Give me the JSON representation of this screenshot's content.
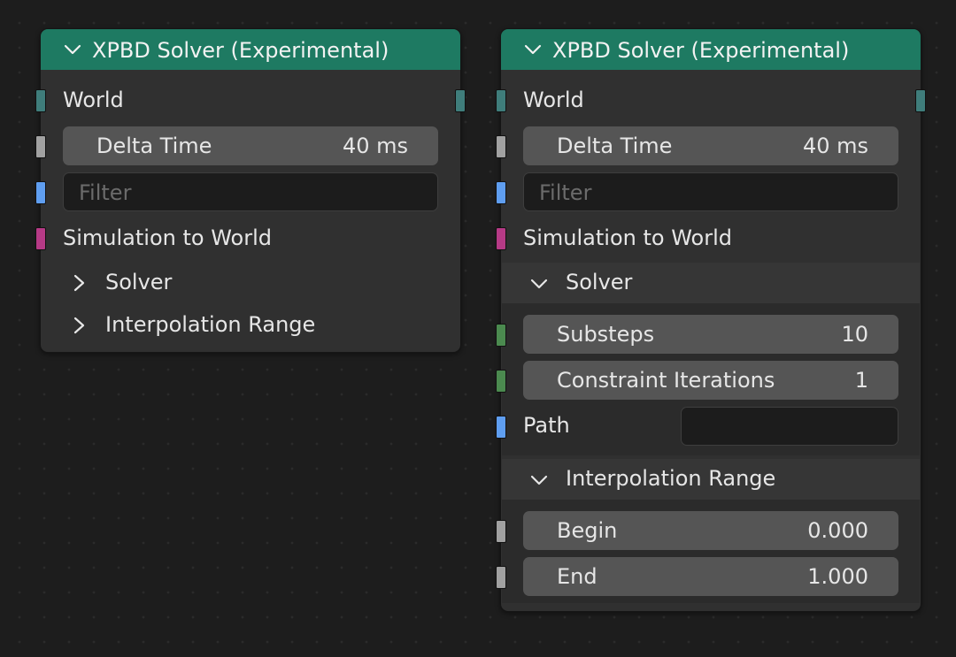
{
  "colors": {
    "header": "#1e7a62",
    "socket_world": "#3f7d7b",
    "socket_float": "#a1a1a1",
    "socket_string": "#5f9ef0",
    "socket_geometry": "#b63a86",
    "socket_int": "#4b8a4f"
  },
  "left_node": {
    "title": "XPBD Solver (Experimental)",
    "world_label": "World",
    "delta_time": {
      "label": "Delta Time",
      "value": "40 ms"
    },
    "filter_placeholder": "Filter",
    "sim_to_world_label": "Simulation to World",
    "solver_panel": {
      "label": "Solver",
      "state": "collapsed"
    },
    "interp_panel": {
      "label": "Interpolation Range",
      "state": "collapsed"
    }
  },
  "right_node": {
    "title": "XPBD Solver (Experimental)",
    "world_label": "World",
    "delta_time": {
      "label": "Delta Time",
      "value": "40 ms"
    },
    "filter_placeholder": "Filter",
    "sim_to_world_label": "Simulation to World",
    "solver_panel": {
      "label": "Solver",
      "state": "expanded",
      "substeps": {
        "label": "Substeps",
        "value": "10"
      },
      "constraint_iterations": {
        "label": "Constraint Iterations",
        "value": "1"
      },
      "path": {
        "label": "Path",
        "value": ""
      }
    },
    "interp_panel": {
      "label": "Interpolation Range",
      "state": "expanded",
      "begin": {
        "label": "Begin",
        "value": "0.000"
      },
      "end": {
        "label": "End",
        "value": "1.000"
      }
    }
  }
}
